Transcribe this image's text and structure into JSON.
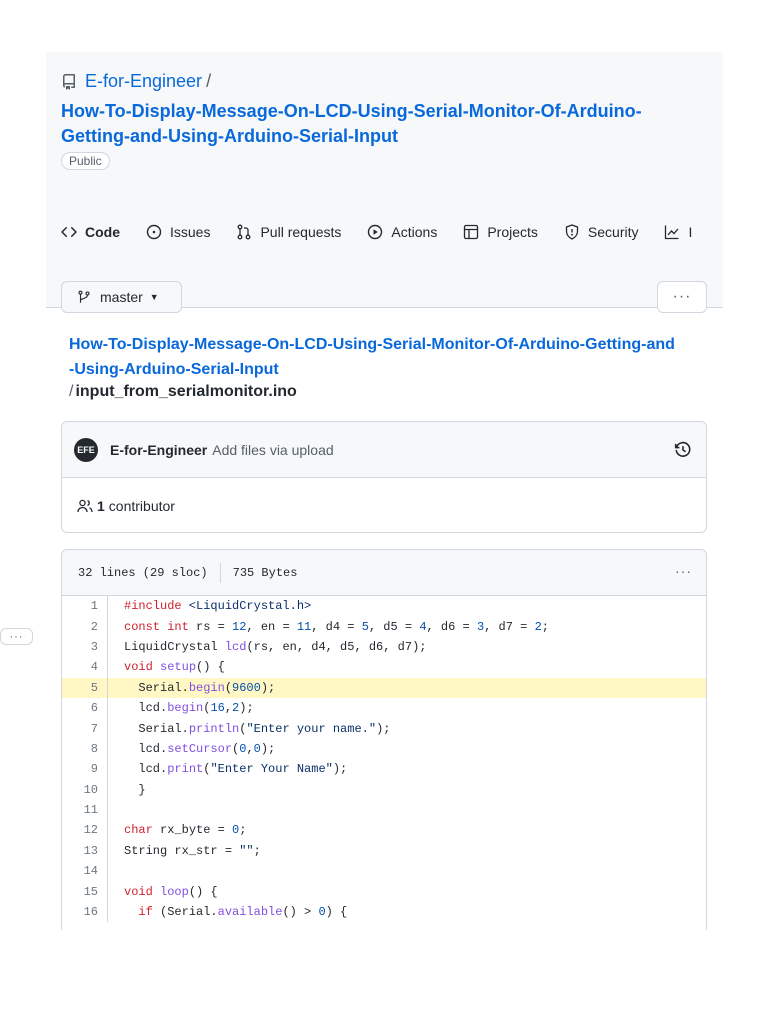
{
  "repo": {
    "owner": "E-for-Engineer",
    "separator": "/",
    "name": "How-To-Display-Message-On-LCD-Using-Serial-Monitor-Of-Arduino-Getting-and-Using-Arduino-Serial-Input",
    "visibility": "Public"
  },
  "tabs": [
    {
      "label": "Code",
      "icon": "code-icon",
      "active": true
    },
    {
      "label": "Issues",
      "icon": "issue-icon"
    },
    {
      "label": "Pull requests",
      "icon": "pull-request-icon"
    },
    {
      "label": "Actions",
      "icon": "play-icon"
    },
    {
      "label": "Projects",
      "icon": "table-icon"
    },
    {
      "label": "Security",
      "icon": "shield-icon"
    },
    {
      "label": "Insights",
      "icon": "graph-icon",
      "visible_text": "I"
    }
  ],
  "branch": {
    "label": "master",
    "icon": "git-branch-icon"
  },
  "more_button": "···",
  "breadcrumb": {
    "repo_link_line1": "How-To-Display-Message-On-LCD-Using-Serial-Monitor-Of-Arduino-Getting-and",
    "repo_link_line2": "-Using-Arduino-Serial-Input",
    "separator": "/",
    "file_name": "input_from_serialmonitor.ino"
  },
  "commit": {
    "avatar_text": "EFE",
    "author": "E-for-Engineer",
    "message": "Add files via upload",
    "history_icon": "history-icon"
  },
  "contributors": {
    "count": "1",
    "label": "contributor",
    "icon": "people-icon"
  },
  "file_info": {
    "lines": "32 lines (29 sloc)",
    "size": "735 Bytes",
    "menu": "···"
  },
  "code_lines": [
    {
      "n": "1",
      "text": "#include <LiquidCrystal.h>"
    },
    {
      "n": "2",
      "text": "const int rs = 12, en = 11, d4 = 5, d5 = 4, d6 = 3, d7 = 2;"
    },
    {
      "n": "3",
      "text": "LiquidCrystal lcd(rs, en, d4, d5, d6, d7);"
    },
    {
      "n": "4",
      "text": "void setup() {"
    },
    {
      "n": "5",
      "text": "  Serial.begin(9600);",
      "highlighted": true
    },
    {
      "n": "6",
      "text": "  lcd.begin(16,2);"
    },
    {
      "n": "7",
      "text": "  Serial.println(\"Enter your name.\");"
    },
    {
      "n": "8",
      "text": "  lcd.setCursor(0,0);"
    },
    {
      "n": "9",
      "text": "  lcd.print(\"Enter Your Name\");"
    },
    {
      "n": "10",
      "text": "  }"
    },
    {
      "n": "11",
      "text": ""
    },
    {
      "n": "12",
      "text": "char rx_byte = 0;"
    },
    {
      "n": "13",
      "text": "String rx_str = \"\";"
    },
    {
      "n": "14",
      "text": ""
    },
    {
      "n": "15",
      "text": "void loop() {"
    },
    {
      "n": "16",
      "text": "  if (Serial.available() > 0) {"
    }
  ],
  "line_menu": "···",
  "colors": {
    "link": "#0969da",
    "active_tab_underline": "#fd8c73",
    "highlight": "#fff8c5",
    "keyword": "#cf222e",
    "number": "#0550ae",
    "function": "#8250df"
  }
}
